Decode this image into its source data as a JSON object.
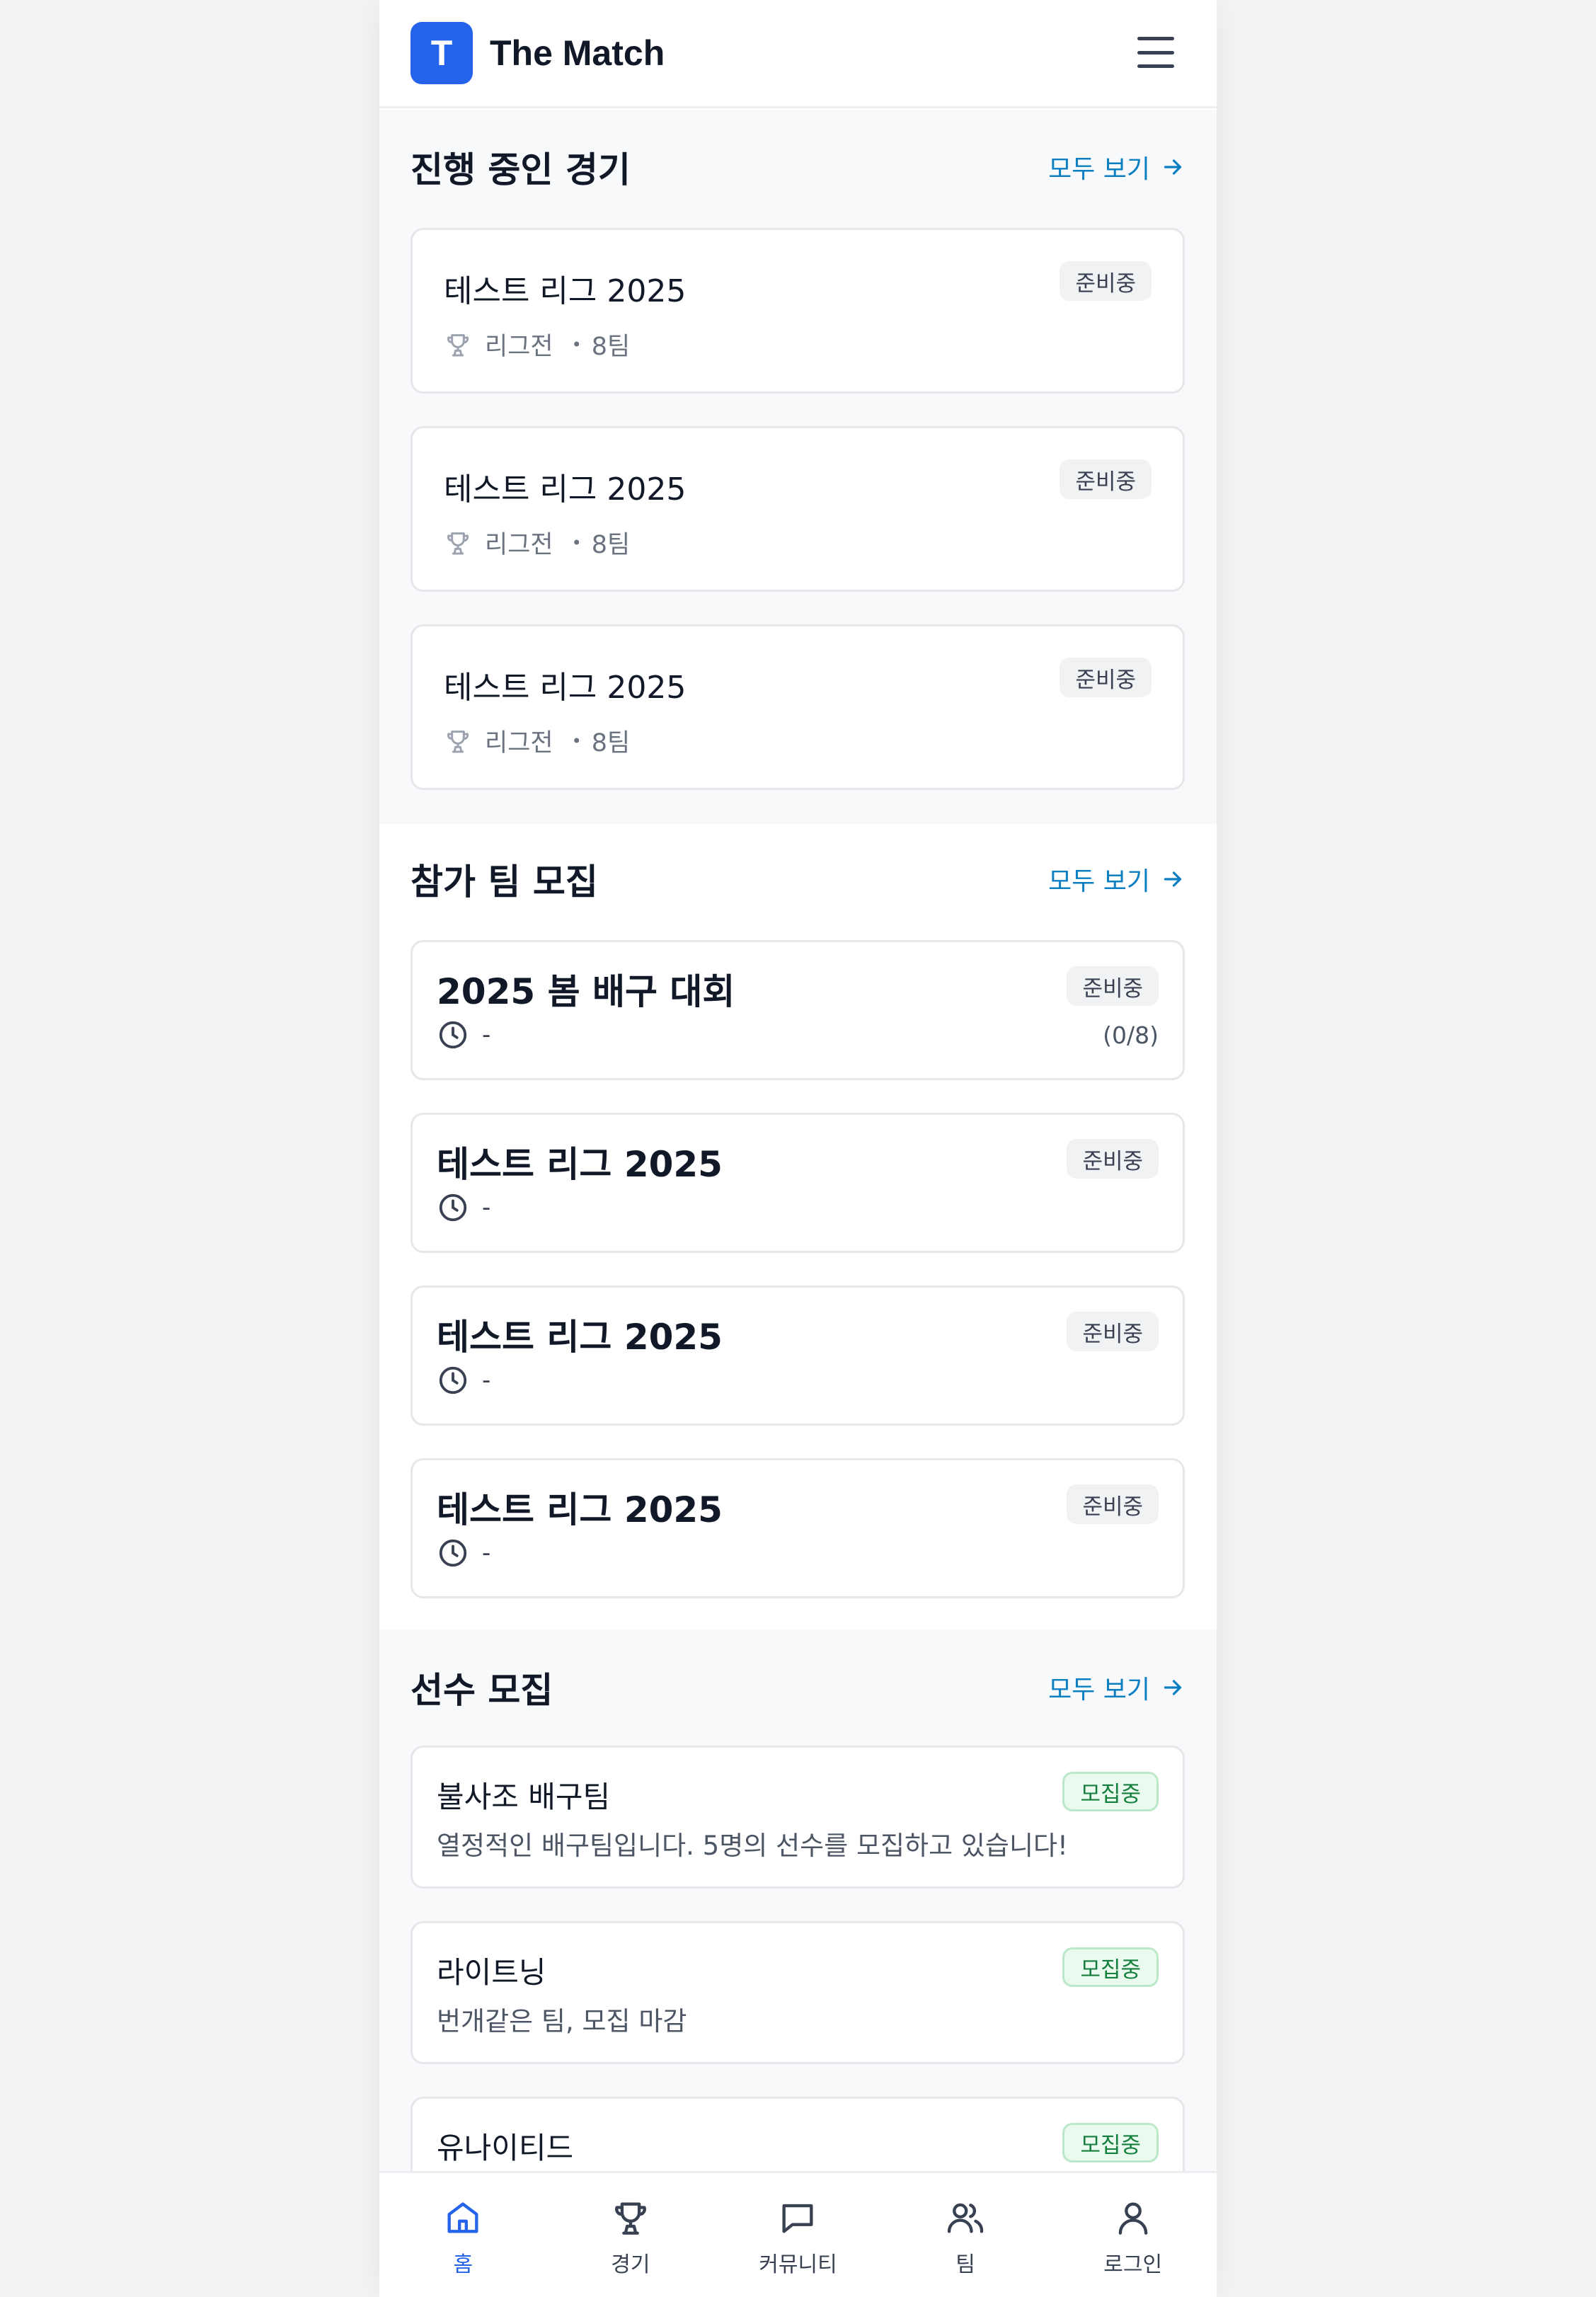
{
  "app": {
    "logo_letter": "T",
    "title": "The Match"
  },
  "sections": {
    "matches": {
      "title": "진행 중인 경기",
      "see_all": "모두 보기",
      "items": [
        {
          "name": "테스트 리그 2025",
          "status": "준비중",
          "format": "리그전",
          "teams": "8팀"
        },
        {
          "name": "테스트 리그 2025",
          "status": "준비중",
          "format": "리그전",
          "teams": "8팀"
        },
        {
          "name": "테스트 리그 2025",
          "status": "준비중",
          "format": "리그전",
          "teams": "8팀"
        }
      ]
    },
    "team_recruit": {
      "title": "참가 팀 모집",
      "see_all": "모두 보기",
      "items": [
        {
          "name": "2025 봄 배구 대회",
          "status": "준비중",
          "time": "-",
          "count": "(0/8)"
        },
        {
          "name": "테스트 리그 2025",
          "status": "준비중",
          "time": "-"
        },
        {
          "name": "테스트 리그 2025",
          "status": "준비중",
          "time": "-"
        },
        {
          "name": "테스트 리그 2025",
          "status": "준비중",
          "time": "-"
        }
      ]
    },
    "player_recruit": {
      "title": "선수 모집",
      "see_all": "모두 보기",
      "items": [
        {
          "name": "불사조 배구팀",
          "status": "모집중",
          "desc": "열정적인 배구팀입니다. 5명의 선수를 모집하고 있습니다!"
        },
        {
          "name": "라이트닝",
          "status": "모집중",
          "desc": "번개같은 팀, 모집 마감"
        },
        {
          "name": "유나이티드",
          "status": "모집중",
          "desc": ""
        }
      ]
    }
  },
  "bottom_nav": {
    "items": [
      {
        "label": "홈",
        "icon": "home-icon",
        "active": true
      },
      {
        "label": "경기",
        "icon": "trophy-icon"
      },
      {
        "label": "커뮤니티",
        "icon": "chat-icon"
      },
      {
        "label": "팀",
        "icon": "users-icon"
      },
      {
        "label": "로그인",
        "icon": "user-icon"
      }
    ]
  },
  "colors": {
    "brand": "#2563eb",
    "link": "#0b7fc2",
    "recruit_green": "#15803d"
  }
}
